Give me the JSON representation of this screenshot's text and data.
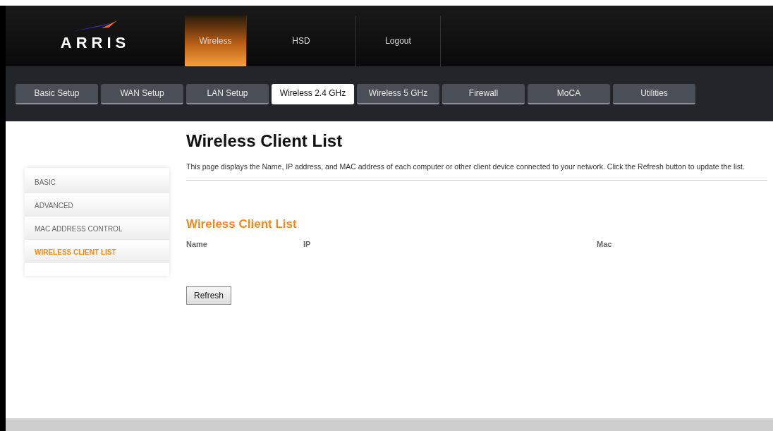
{
  "logo": {
    "text": "ARRIS"
  },
  "main_tabs": [
    {
      "label": "Wireless",
      "selected": true
    },
    {
      "label": "HSD",
      "selected": false
    },
    {
      "label": "Logout",
      "selected": false
    }
  ],
  "sub_tabs": [
    {
      "label": "Basic Setup",
      "selected": false
    },
    {
      "label": "WAN Setup",
      "selected": false
    },
    {
      "label": "LAN Setup",
      "selected": false
    },
    {
      "label": "Wireless 2.4 GHz",
      "selected": true
    },
    {
      "label": "Wireless 5 GHz",
      "selected": false
    },
    {
      "label": "Firewall",
      "selected": false
    },
    {
      "label": "MoCA",
      "selected": false
    },
    {
      "label": "Utilities",
      "selected": false
    }
  ],
  "sidebar": {
    "items": [
      {
        "label": "BASIC",
        "selected": false
      },
      {
        "label": "ADVANCED",
        "selected": false
      },
      {
        "label": "MAC ADDRESS CONTROL",
        "selected": false
      },
      {
        "label": "WIRELESS CLIENT LIST",
        "selected": true
      }
    ]
  },
  "page_title": "Wireless Client List",
  "description": "This page displays the Name, IP address, and MAC address of each computer or other client device connected to your network. Click the Refresh button to update the list.",
  "client_list": {
    "title": "Wireless Client List",
    "columns": [
      "Name",
      "IP",
      "Mac"
    ]
  },
  "refresh_button": "Refresh"
}
